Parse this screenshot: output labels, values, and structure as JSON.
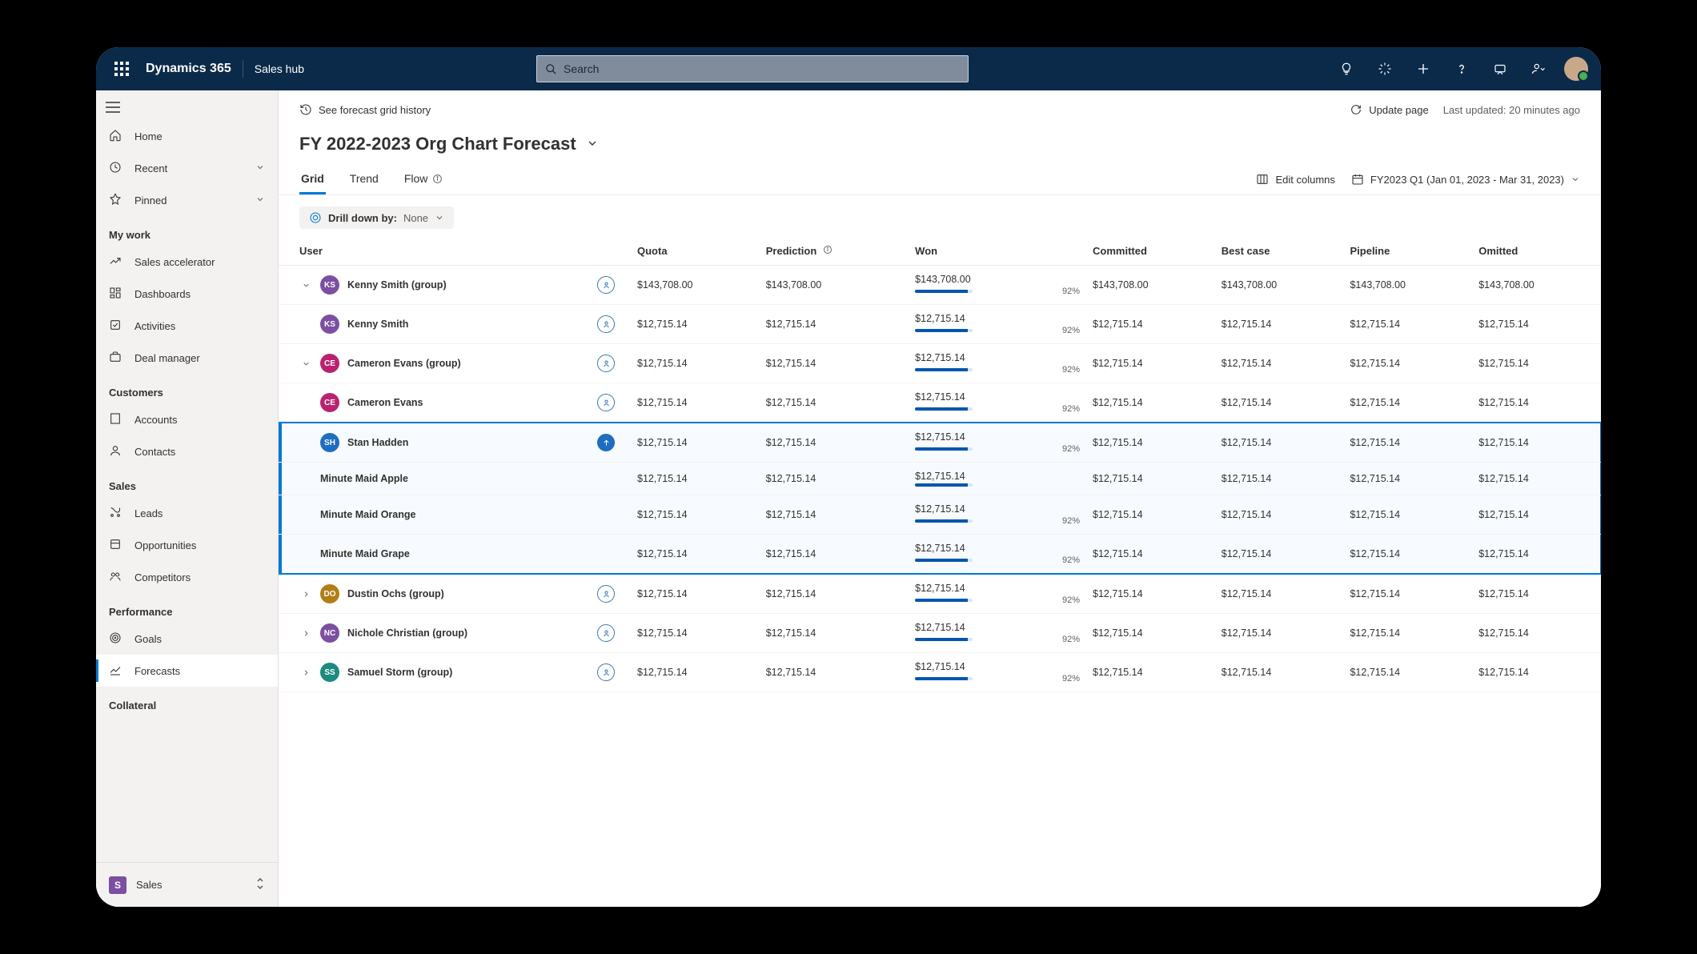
{
  "topbar": {
    "brand": "Dynamics 365",
    "hub": "Sales hub",
    "search_placeholder": "Search"
  },
  "sidebar": {
    "items_top": [
      {
        "icon": "home",
        "label": "Home"
      },
      {
        "icon": "recent",
        "label": "Recent",
        "chevron": true
      },
      {
        "icon": "pinned",
        "label": "Pinned",
        "chevron": true
      }
    ],
    "sections": [
      {
        "title": "My work",
        "items": [
          {
            "icon": "accel",
            "label": "Sales accelerator"
          },
          {
            "icon": "dash",
            "label": "Dashboards"
          },
          {
            "icon": "act",
            "label": "Activities"
          },
          {
            "icon": "deal",
            "label": "Deal manager"
          }
        ]
      },
      {
        "title": "Customers",
        "items": [
          {
            "icon": "accounts",
            "label": "Accounts"
          },
          {
            "icon": "contacts",
            "label": "Contacts"
          }
        ]
      },
      {
        "title": "Sales",
        "items": [
          {
            "icon": "leads",
            "label": "Leads"
          },
          {
            "icon": "opps",
            "label": "Opportunities"
          },
          {
            "icon": "comp",
            "label": "Competitors"
          }
        ]
      },
      {
        "title": "Performance",
        "items": [
          {
            "icon": "goals",
            "label": "Goals"
          },
          {
            "icon": "forecast",
            "label": "Forecasts",
            "selected": true
          }
        ]
      },
      {
        "title": "Collateral",
        "items": []
      }
    ],
    "module": {
      "badge": "S",
      "label": "Sales"
    }
  },
  "commandbar": {
    "history": "See forecast grid history",
    "update": "Update page",
    "lastUpdated": "Last updated: 20 minutes ago"
  },
  "page": {
    "title": "FY 2022-2023 Org Chart Forecast",
    "tabs": [
      {
        "label": "Grid",
        "active": true
      },
      {
        "label": "Trend"
      },
      {
        "label": "Flow",
        "info": true
      }
    ],
    "editColumns": "Edit columns",
    "period": "FY2023 Q1 (Jan 01, 2023 - Mar 31, 2023)",
    "drilldown": {
      "label": "Drill down by:",
      "value": "None"
    }
  },
  "columns": [
    "User",
    "Quota",
    "Prediction",
    "Won",
    "Committed",
    "Best case",
    "Pipeline",
    "Omitted"
  ],
  "rows": [
    {
      "indent": 0,
      "caret": "down",
      "avatar": "KS",
      "color": "#7b4fa2",
      "name": "Kenny Smith (group)",
      "icon": "outline",
      "quota": "$143,708.00",
      "prediction": "$143,708.00",
      "won": "$143,708.00",
      "pct": "92%",
      "committed": "$143,708.00",
      "best": "$143,708.00",
      "pipeline": "$143,708.00",
      "omitted": "$143,708.00"
    },
    {
      "indent": 1,
      "caret": "",
      "avatar": "KS",
      "color": "#7b4fa2",
      "name": "Kenny Smith",
      "icon": "outline",
      "quota": "$12,715.14",
      "prediction": "$12,715.14",
      "won": "$12,715.14",
      "pct": "92%",
      "committed": "$12,715.14",
      "best": "$12,715.14",
      "pipeline": "$12,715.14",
      "omitted": "$12,715.14"
    },
    {
      "indent": 1,
      "caret": "down",
      "avatar": "CE",
      "color": "#ba2270",
      "name": "Cameron Evans (group)",
      "icon": "outline",
      "quota": "$12,715.14",
      "prediction": "$12,715.14",
      "won": "$12,715.14",
      "pct": "92%",
      "committed": "$12,715.14",
      "best": "$12,715.14",
      "pipeline": "$12,715.14",
      "omitted": "$12,715.14"
    },
    {
      "indent": 2,
      "caret": "",
      "avatar": "CE",
      "color": "#ba2270",
      "name": "Cameron Evans",
      "icon": "outline",
      "quota": "$12,715.14",
      "prediction": "$12,715.14",
      "won": "$12,715.14",
      "pct": "92%",
      "committed": "$12,715.14",
      "best": "$12,715.14",
      "pipeline": "$12,715.14",
      "omitted": "$12,715.14"
    },
    {
      "indent": 2,
      "caret": "",
      "avatar": "SH",
      "color": "#1e6dc0",
      "name": "Stan Hadden",
      "icon": "solid",
      "highlight": "top",
      "quota": "$12,715.14",
      "prediction": "$12,715.14",
      "won": "$12,715.14",
      "pct": "92%",
      "committed": "$12,715.14",
      "best": "$12,715.14",
      "pipeline": "$12,715.14",
      "omitted": "$12,715.14"
    },
    {
      "indent": 3,
      "caret": "",
      "avatar": "",
      "color": "",
      "name": "Minute Maid Apple",
      "icon": "",
      "highlight": "mid",
      "quota": "$12,715.14",
      "prediction": "$12,715.14",
      "won": "$12,715.14",
      "pct": "",
      "committed": "$12,715.14",
      "best": "$12,715.14",
      "pipeline": "$12,715.14",
      "omitted": "$12,715.14"
    },
    {
      "indent": 3,
      "caret": "",
      "avatar": "",
      "color": "",
      "name": "Minute Maid Orange",
      "icon": "",
      "highlight": "mid",
      "quota": "$12,715.14",
      "prediction": "$12,715.14",
      "won": "$12,715.14",
      "pct": "92%",
      "committed": "$12,715.14",
      "best": "$12,715.14",
      "pipeline": "$12,715.14",
      "omitted": "$12,715.14"
    },
    {
      "indent": 3,
      "caret": "",
      "avatar": "",
      "color": "",
      "name": "Minute Maid Grape",
      "icon": "",
      "highlight": "bottom",
      "quota": "$12,715.14",
      "prediction": "$12,715.14",
      "won": "$12,715.14",
      "pct": "92%",
      "committed": "$12,715.14",
      "best": "$12,715.14",
      "pipeline": "$12,715.14",
      "omitted": "$12,715.14"
    },
    {
      "indent": 1,
      "caret": "right",
      "avatar": "DO",
      "color": "#b37d16",
      "name": "Dustin Ochs (group)",
      "icon": "outline",
      "quota": "$12,715.14",
      "prediction": "$12,715.14",
      "won": "$12,715.14",
      "pct": "92%",
      "committed": "$12,715.14",
      "best": "$12,715.14",
      "pipeline": "$12,715.14",
      "omitted": "$12,715.14"
    },
    {
      "indent": 1,
      "caret": "right",
      "avatar": "NC",
      "color": "#7b4fa2",
      "name": "Nichole Christian (group)",
      "icon": "outline",
      "quota": "$12,715.14",
      "prediction": "$12,715.14",
      "won": "$12,715.14",
      "pct": "92%",
      "committed": "$12,715.14",
      "best": "$12,715.14",
      "pipeline": "$12,715.14",
      "omitted": "$12,715.14"
    },
    {
      "indent": 1,
      "caret": "right",
      "avatar": "SS",
      "color": "#1d8a7d",
      "name": "Samuel Storm (group)",
      "icon": "outline",
      "quota": "$12,715.14",
      "prediction": "$12,715.14",
      "won": "$12,715.14",
      "pct": "92%",
      "committed": "$12,715.14",
      "best": "$12,715.14",
      "pipeline": "$12,715.14",
      "omitted": "$12,715.14"
    }
  ]
}
